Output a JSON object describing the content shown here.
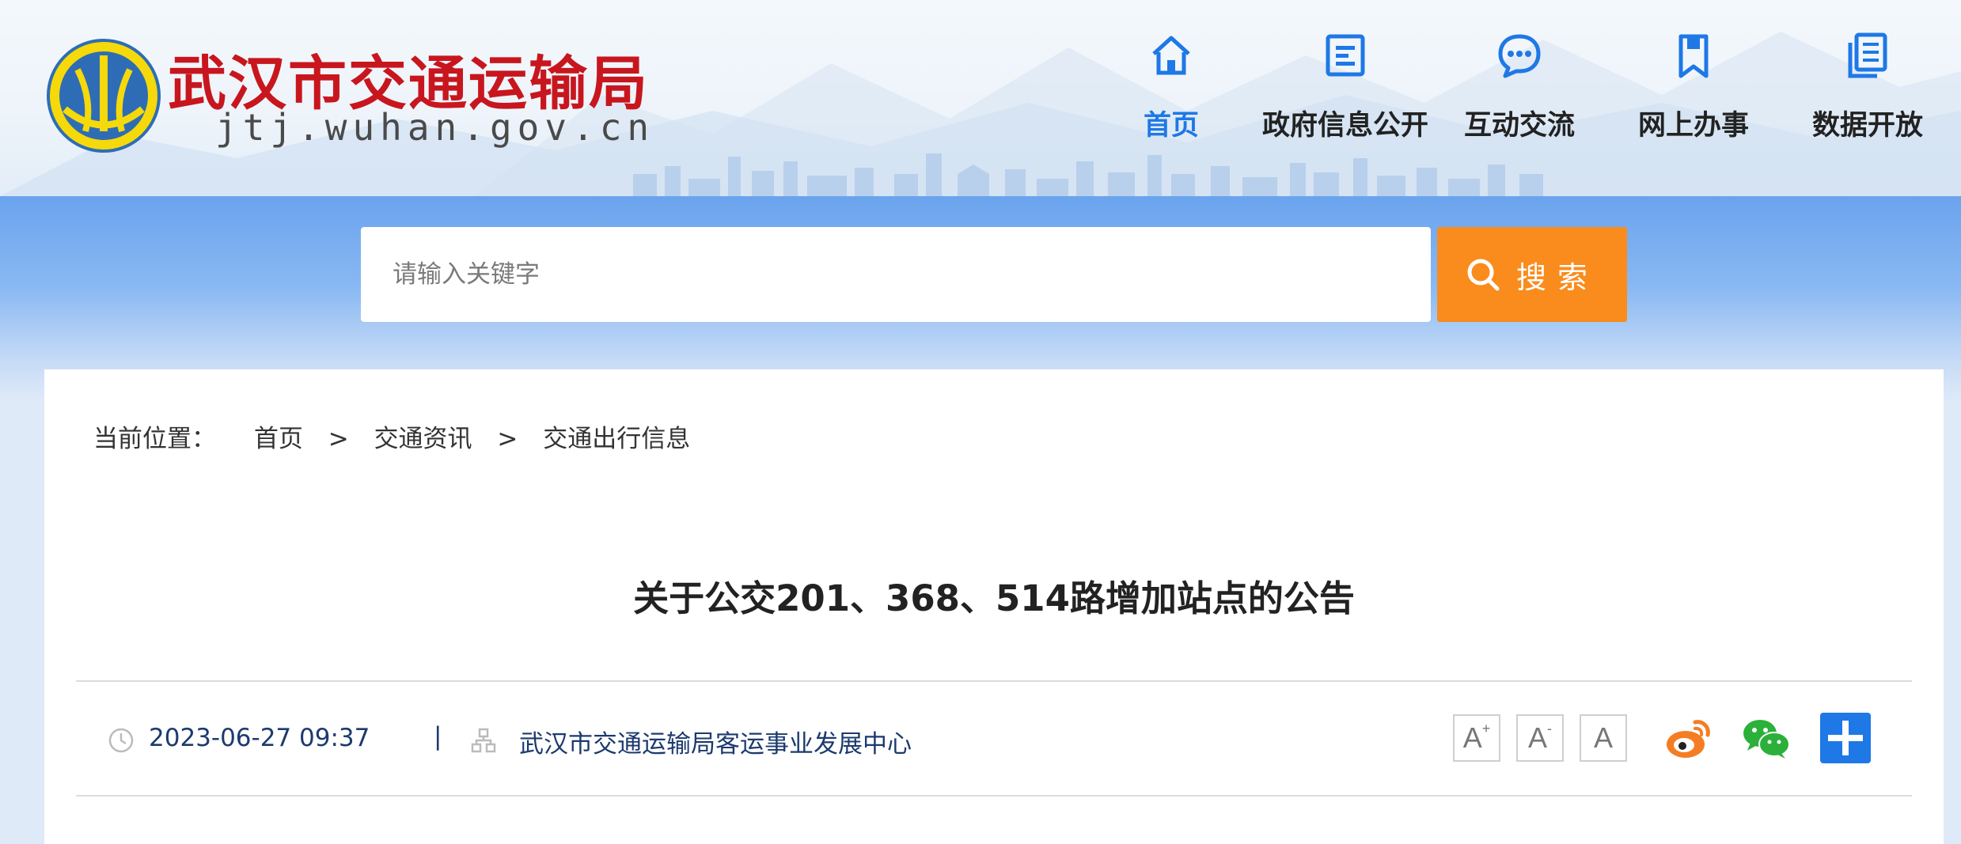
{
  "colors": {
    "brand_red": "#c8161e",
    "nav_active": "#1e78e6",
    "search_button": "#f98c1c",
    "meta_text": "#1c3a6e",
    "weibo": "#f47d23",
    "wechat": "#2bb03a",
    "share_more": "#1e78e6"
  },
  "header": {
    "site_title": "武汉市交通运输局",
    "site_domain": "jtj.wuhan.gov.cn",
    "logo_icon": "wuhan-emblem-icon"
  },
  "nav": {
    "items": [
      {
        "label": "首页",
        "icon": "home-icon",
        "active": true
      },
      {
        "label": "政府信息公开",
        "icon": "document-icon",
        "active": false
      },
      {
        "label": "互动交流",
        "icon": "chat-bubble-icon",
        "active": false
      },
      {
        "label": "网上办事",
        "icon": "bookmark-icon",
        "active": false
      },
      {
        "label": "数据开放",
        "icon": "data-files-icon",
        "active": false
      }
    ]
  },
  "search": {
    "placeholder": "请输入关键字",
    "value": "",
    "button_label": "搜索",
    "button_icon": "search-icon"
  },
  "breadcrumb": {
    "prefix": "当前位置：",
    "items": [
      "首页",
      "交通资讯",
      "交通出行信息"
    ],
    "separator": ">"
  },
  "article": {
    "title": "关于公交201、368、514路增加站点的公告",
    "date": "2023-06-27 09:37",
    "separator": "|",
    "source": "武汉市交通运输局客运事业发展中心"
  },
  "font_controls": {
    "increase_label": "A",
    "increase_mark": "+",
    "decrease_label": "A",
    "decrease_mark": "-",
    "reset_label": "A"
  },
  "share": {
    "items": [
      {
        "icon": "weibo-icon"
      },
      {
        "icon": "wechat-icon"
      },
      {
        "icon": "share-more-icon"
      }
    ]
  }
}
